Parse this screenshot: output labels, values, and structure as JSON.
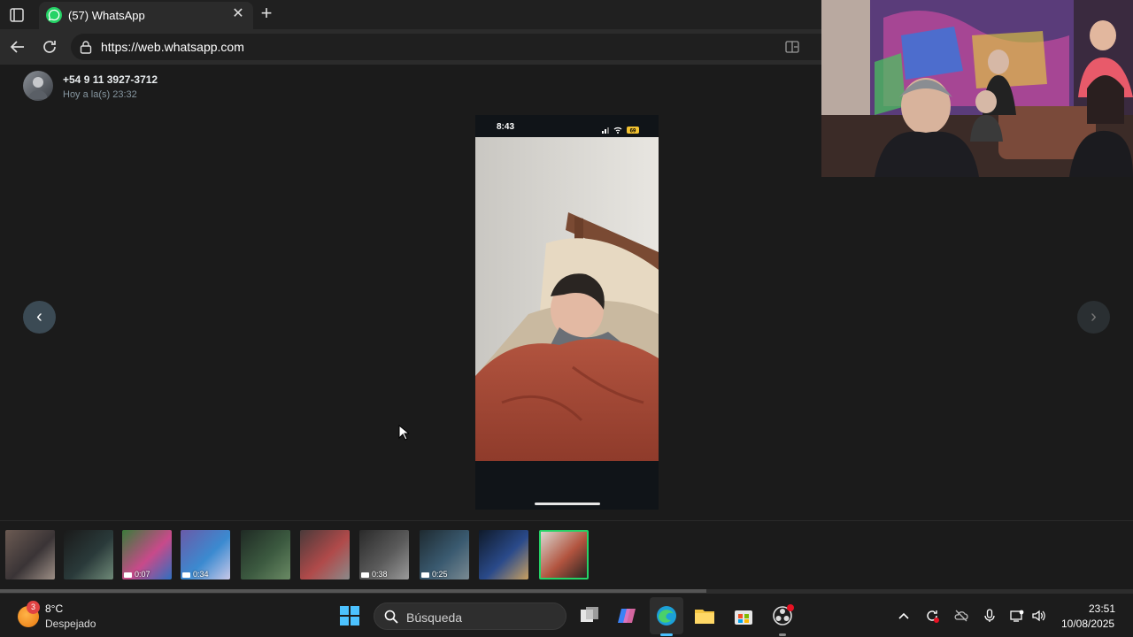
{
  "browser": {
    "tab_title": "(57) WhatsApp",
    "url": "https://web.whatsapp.com",
    "close_glyph": "✕",
    "new_tab_glyph": "+"
  },
  "viewer": {
    "sender": "+54 9 11 3927-3712",
    "timestamp": "Hoy a la(s) 23:32",
    "prev_glyph": "‹",
    "next_glyph": "›"
  },
  "phone": {
    "status_time": "8:43",
    "battery": "69"
  },
  "thumbnails": [
    {
      "duration": ""
    },
    {
      "duration": ""
    },
    {
      "duration": "0:07"
    },
    {
      "duration": "0:34"
    },
    {
      "duration": ""
    },
    {
      "duration": ""
    },
    {
      "duration": "0:38"
    },
    {
      "duration": "0:25"
    },
    {
      "duration": ""
    },
    {
      "duration": "",
      "selected": true
    }
  ],
  "taskbar": {
    "weather_badge": "3",
    "weather_temp": "8°C",
    "weather_desc": "Despejado",
    "search_label": "Búsqueda",
    "clock_time": "23:51",
    "clock_date": "10/08/2025"
  },
  "colors": {
    "accent": "#25d366",
    "background": "#1b1b1b"
  }
}
